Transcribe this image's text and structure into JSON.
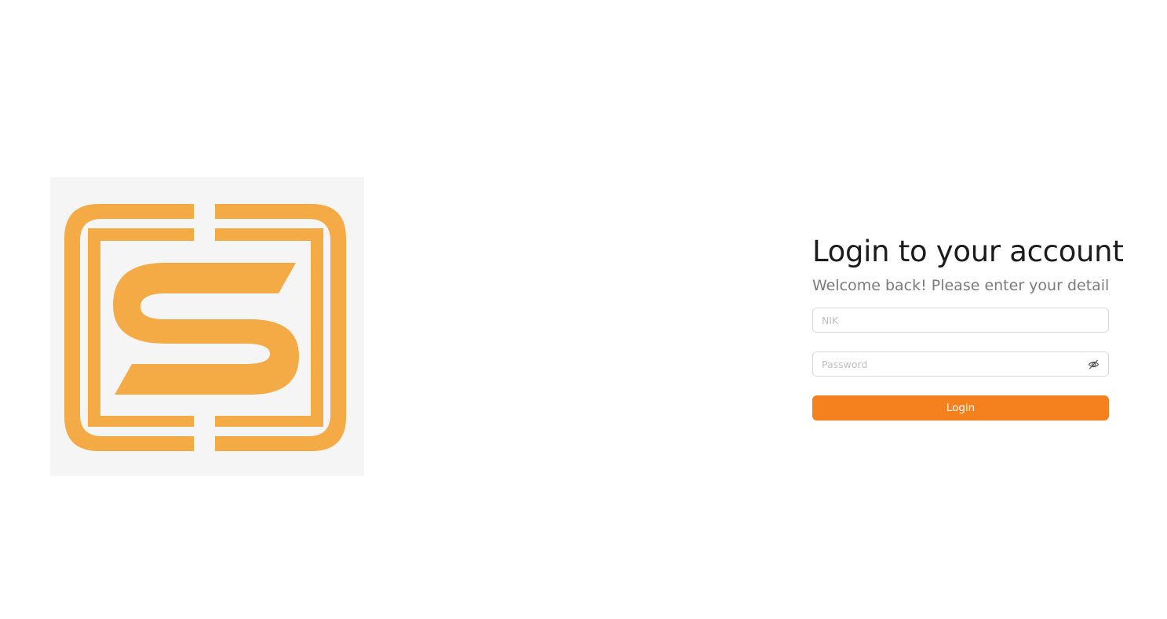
{
  "logo": {
    "icon": "s-bracket-logo-icon",
    "color": "#f4ab45",
    "background": "#f5f5f5"
  },
  "login": {
    "title": "Login to your account",
    "subtitle": "Welcome back! Please enter your detail",
    "nik_placeholder": "NIK",
    "nik_value": "",
    "password_placeholder": "Password",
    "password_value": "",
    "password_toggle_icon": "eye-slash-icon",
    "button_label": "Login",
    "accent_color": "#f4811e"
  }
}
